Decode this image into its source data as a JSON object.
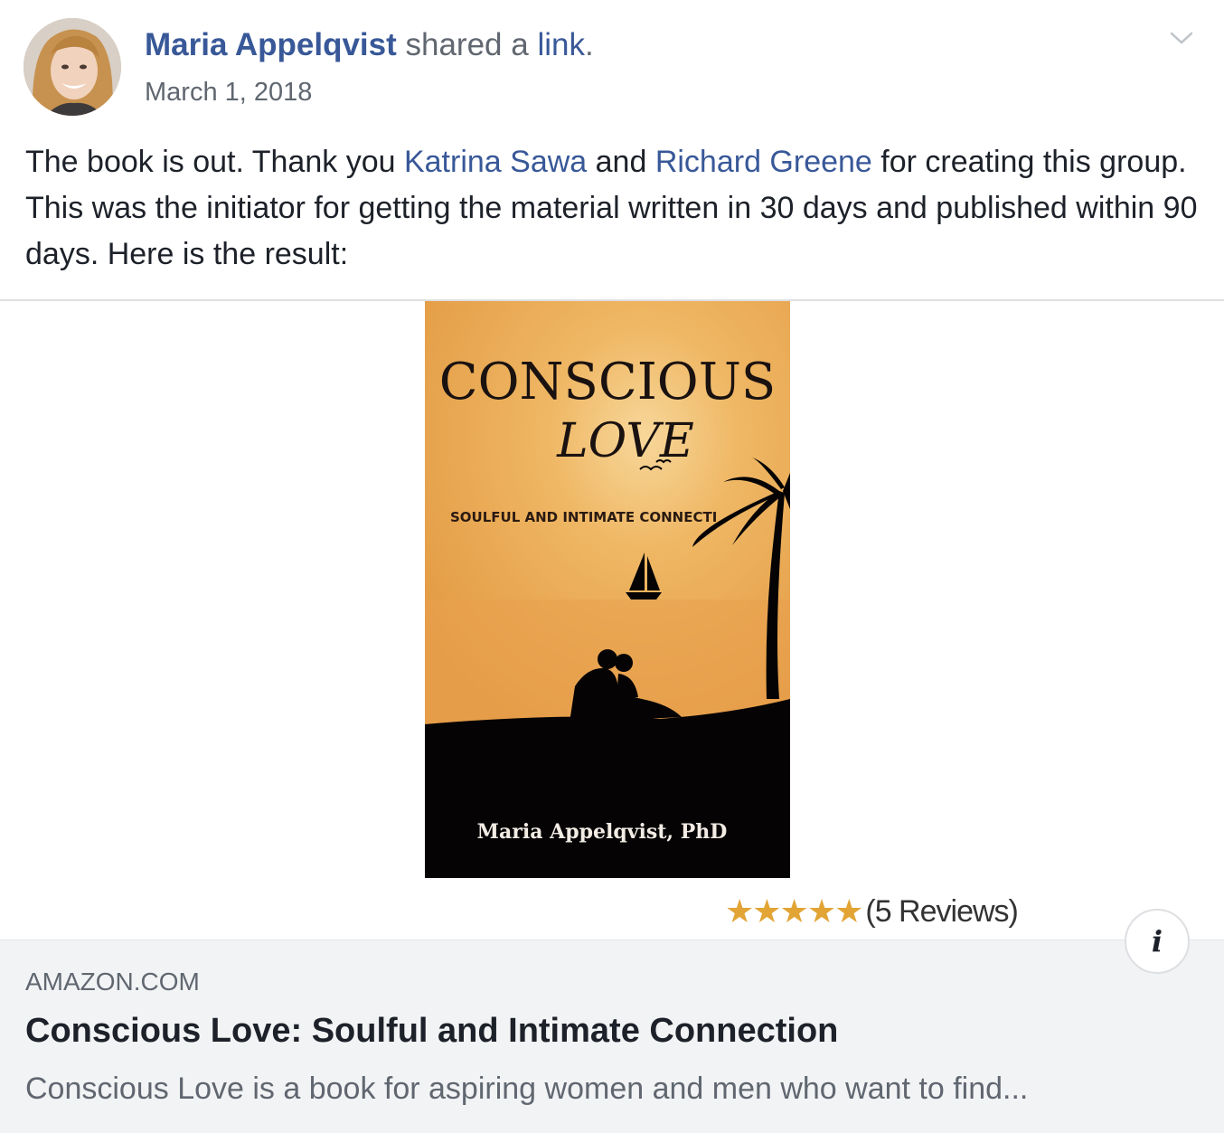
{
  "post": {
    "author": "Maria Appelqvist",
    "action_text": " shared a ",
    "action_link": "link",
    "action_end": ".",
    "date": "March 1, 2018",
    "message": {
      "part1": "The book is out. Thank you ",
      "mention1": "Katrina Sawa",
      "part2": " and ",
      "mention2": "Richard Greene",
      "part3": " for creating this group. This was the initiator for getting the material written in 30 days and published within 90 days. Here is the result:"
    }
  },
  "book": {
    "title_line1": "CONSCIOUS",
    "title_line2": "LOVE",
    "subtitle": "SOULFUL AND INTIMATE CONNECTI",
    "author": "Maria Appelqvist, PhD"
  },
  "rating": {
    "stars": "★★★★★",
    "value": 5,
    "reviews": "(5 Reviews)"
  },
  "preview": {
    "domain": "AMAZON.COM",
    "title": "Conscious Love: Soulful and Intimate Connection",
    "description": "Conscious Love is a book for aspiring women and men who want to find..."
  },
  "icons": {
    "options": "chevron-down-icon",
    "info": "info-icon"
  },
  "colors": {
    "link": "#385898",
    "secondary_text": "#606770",
    "star": "#e2a435",
    "preview_bg": "#f2f3f5"
  }
}
